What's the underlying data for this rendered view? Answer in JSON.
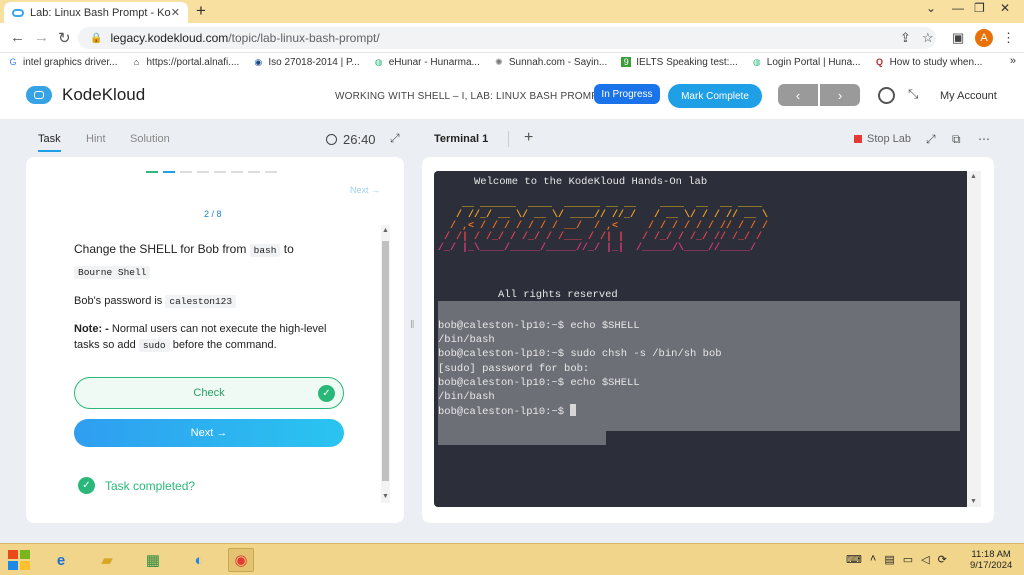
{
  "browser": {
    "tab_title": "Lab: Linux Bash Prompt - KodeKl",
    "url_domain": "legacy.kodekloud.com",
    "url_path": "/topic/lab-linux-bash-prompt/",
    "avatar_letter": "A",
    "bookmarks": [
      {
        "label": "intel graphics driver...",
        "icon": "G"
      },
      {
        "label": "https://portal.alnafi....",
        "icon": "⌂"
      },
      {
        "label": "Iso 27018-2014 | P...",
        "icon": "◉"
      },
      {
        "label": "eHunar - Hunarma...",
        "icon": "◍"
      },
      {
        "label": "Sunnah.com - Sayin...",
        "icon": "✺"
      },
      {
        "label": "IELTS Speaking test:...",
        "icon": "9"
      },
      {
        "label": "Login Portal | Huna...",
        "icon": "◍"
      },
      {
        "label": "How to study when...",
        "icon": "Q"
      }
    ],
    "bookmarks_more": "»"
  },
  "app": {
    "logo_text": "KodeKloud",
    "lab_title": "WORKING WITH SHELL – I, LAB: LINUX BASH PROMPT",
    "status_badge": "In Progress",
    "mark_complete": "Mark Complete",
    "prev_arrow": "‹",
    "next_arrow": "›",
    "my_account": "My Account"
  },
  "task_panel": {
    "tabs": [
      "Task",
      "Hint",
      "Solution"
    ],
    "timer": "26:40",
    "next_link": "Next →",
    "progress": "2 / 8",
    "question": {
      "prefix": "Change the SHELL for Bob from ",
      "code1": "bash",
      "mid": " to ",
      "code2": "Bourne Shell"
    },
    "password": {
      "label": "Bob's password is ",
      "code": "caleston123"
    },
    "note": {
      "bold": "Note: -",
      "text1": " Normal users can not execute the high-level tasks so add ",
      "code": "sudo",
      "text2": " before the command."
    },
    "check_label": "Check",
    "next_label": "Next →",
    "task_completed": "Task completed?"
  },
  "terminal": {
    "tab_label": "Terminal 1",
    "add_label": "+",
    "stop_lab": "Stop Lab",
    "welcome": "Welcome to the KodeKloud Hands-On lab",
    "ascii_art": [
      "    __ ______  ____  ______ __ __    ____  __  __ ____",
      "   / //_/ __ \\/ __ \\/ ____// //_/   / __ \\/ / / // __ \\",
      "  / ,< / / / / / / / __/  / ,<     / / / / / / // / / /",
      " / /| / /_/ / /_/ / /___ / /| |   / /_/ / /_/ // /_/ /",
      "/_/ |_\\____/_____/_____//_/ |_|  /_____/\\____//_____/"
    ],
    "rights": "All rights reserved",
    "lines": [
      "bob@caleston-lp10:~$ echo $SHELL",
      "/bin/bash",
      "bob@caleston-lp10:~$ sudo chsh -s /bin/sh bob",
      "[sudo] password for bob:",
      "bob@caleston-lp10:~$ echo $SHELL",
      "/bin/bash"
    ],
    "prompt": "bob@caleston-lp10:~$ ",
    "art_colors": [
      "#f5c518",
      "#f5a623",
      "#f0701e",
      "#e8434f",
      "#d93a7a"
    ]
  },
  "taskbar": {
    "time": "11:18 AM",
    "date": "9/17/2024"
  }
}
